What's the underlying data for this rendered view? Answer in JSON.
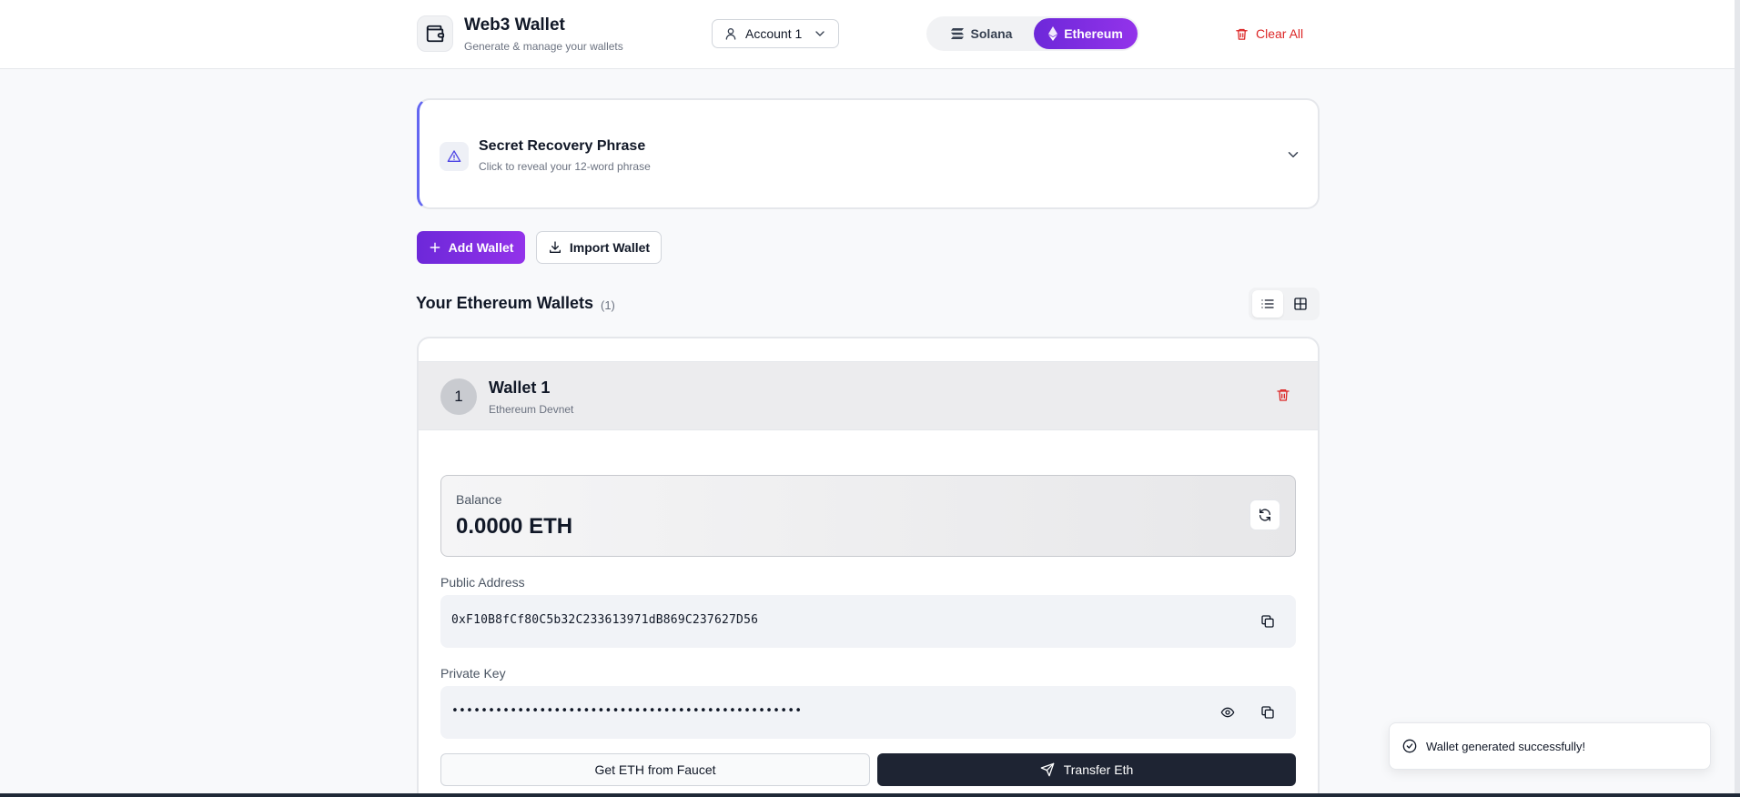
{
  "header": {
    "title": "Web3 Wallet",
    "subtitle": "Generate & manage your wallets",
    "account_label": "Account 1",
    "networks": [
      {
        "label": "Solana",
        "active": false
      },
      {
        "label": "Ethereum",
        "active": true
      }
    ],
    "clear_all_label": "Clear All"
  },
  "secret_phrase": {
    "title": "Secret Recovery Phrase",
    "subtitle": "Click to reveal your 12-word phrase"
  },
  "actions": {
    "add_wallet_label": "Add Wallet",
    "import_wallet_label": "Import Wallet"
  },
  "wallets_section": {
    "title": "Your Ethereum Wallets",
    "count": "(1)",
    "view_mode": "list"
  },
  "wallets": [
    {
      "number": "1",
      "name": "Wallet 1",
      "network": "Ethereum Devnet",
      "balance_label": "Balance",
      "balance": "0.0000 ETH",
      "public_address_label": "Public Address",
      "public_address": "0xF10B8fCf80C5b32C233613971dB869C237627D56",
      "private_key_label": "Private Key",
      "private_key_masked": "••••••••••••••••••••••••••••••••••••••••••••••••",
      "faucet_label": "Get ETH from Faucet",
      "transfer_label": "Transfer Eth"
    }
  ],
  "toast": {
    "message": "Wallet generated successfully!"
  },
  "colors": {
    "accent_start": "#6d28d9",
    "accent_end": "#9333ea",
    "danger": "#dc2626",
    "dark_button": "#1e2433",
    "border_accent": "#6366f1"
  }
}
